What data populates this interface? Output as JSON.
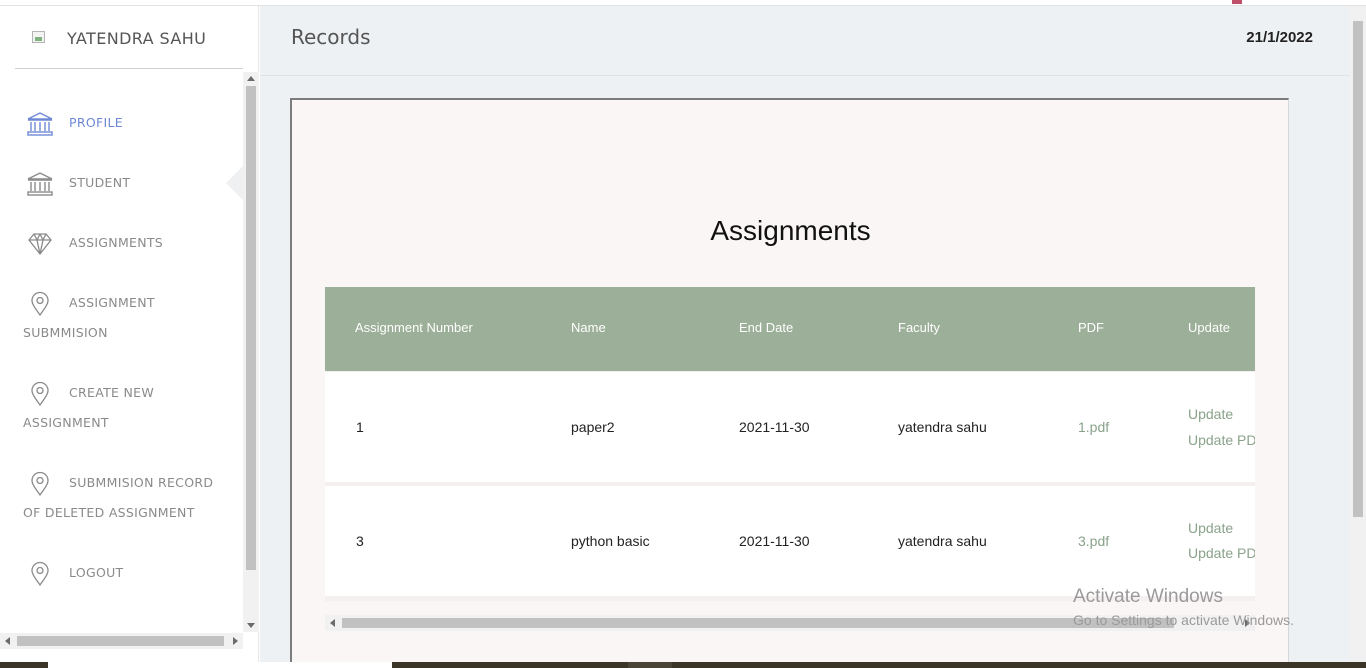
{
  "brand": {
    "name": "YATENDRA SAHU",
    "logo_icon": "broken-image-icon"
  },
  "sidebar": {
    "items": [
      {
        "label": "PROFILE",
        "icon": "bank-icon",
        "active": true
      },
      {
        "label": "STUDENT",
        "icon": "bank-icon",
        "active": false
      },
      {
        "label": "ASSIGNMENTS",
        "icon": "diamond-icon",
        "active": false
      },
      {
        "label": "ASSIGNMENT SUBMMISION",
        "icon": "location-pin-icon",
        "active": false
      },
      {
        "label": "CREATE NEW ASSIGNMENT",
        "icon": "location-pin-icon",
        "active": false
      },
      {
        "label": "SUBMMISION RECORD OF DELETED ASSIGNMENT",
        "icon": "location-pin-icon",
        "active": false
      },
      {
        "label": "LOGOUT",
        "icon": "location-pin-icon",
        "active": false
      }
    ]
  },
  "header": {
    "title": "Records",
    "date": "21/1/2022"
  },
  "section": {
    "heading": "Assignments",
    "table": {
      "columns": [
        "Assignment Number",
        "Name",
        "End Date",
        "Faculty",
        "PDF",
        "Update"
      ],
      "rows": [
        {
          "number": "1",
          "name": "paper2",
          "end_date": "2021-11-30",
          "faculty": "yatendra sahu",
          "pdf": "1.pdf",
          "update": "Update",
          "update_pdf": "Update PDF"
        },
        {
          "number": "3",
          "name": "python basic",
          "end_date": "2021-11-30",
          "faculty": "yatendra sahu",
          "pdf": "3.pdf",
          "update": "Update",
          "update_pdf": "Update PDF"
        }
      ]
    }
  },
  "watermark": {
    "line1": "Activate Windows",
    "line2": "Go to Settings to activate Windows."
  },
  "colors": {
    "active_nav": "#6e88d6",
    "table_header": "#9caf98",
    "link": "#8aa28a",
    "panel_bg": "#faf6f5",
    "main_bg": "#eef1f3"
  }
}
